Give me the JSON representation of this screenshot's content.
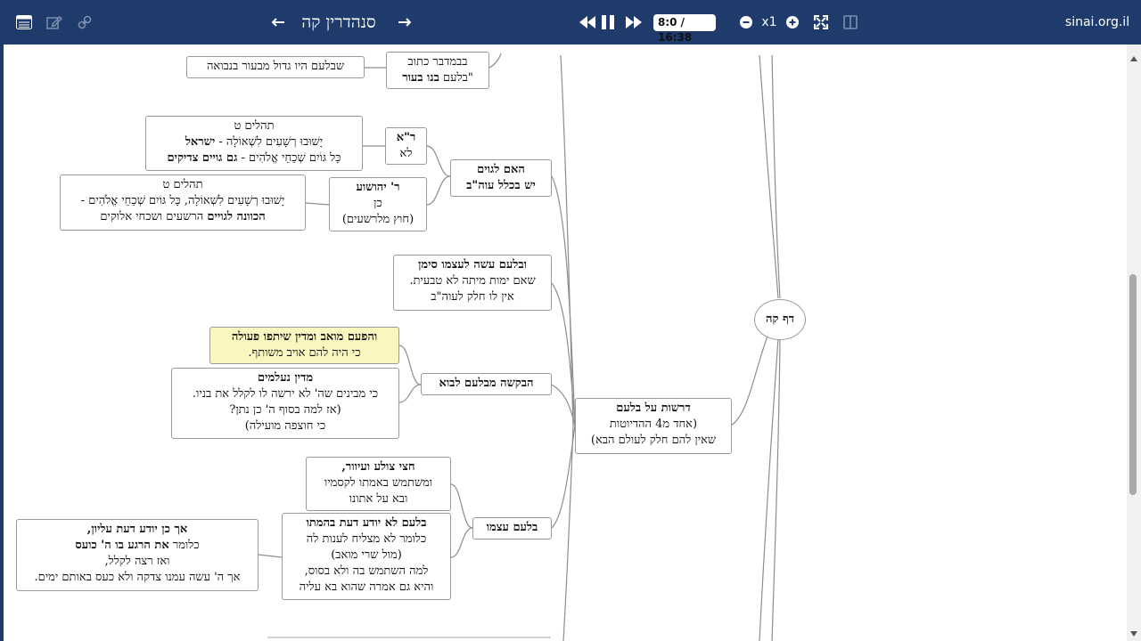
{
  "topbar": {
    "title": "סנהדרין קה",
    "time": "8:0 / 16:38",
    "zoom": "x1",
    "site": "sinai.org.il"
  },
  "nodes": {
    "daf": {
      "text": "דף קה"
    },
    "drashot": {
      "l1": "דרשות על בלעם",
      "l2": "(אחד מ4 ההדיוטות",
      "l3": "שאין להם חלק לעולם הבא)"
    },
    "bamidbar": {
      "l1": "בבמדבר כתוב",
      "l2a": "\"בלעם ",
      "l2b": "בנו בעור"
    },
    "navua": {
      "text": "שבלעם היו גדול מבעור בנבואה"
    },
    "goyim": {
      "l1": "האם לגוים",
      "l2": "יש בכלל עוה\"ב"
    },
    "ra": {
      "l1": "ר\"א",
      "l2": "לא"
    },
    "ryehoshua": {
      "l1": "ר' יהושוע",
      "l2": "כן",
      "l3": "(חוץ מלרשעים)"
    },
    "tehilim1": {
      "l1": "תהלים ט",
      "l2a": "יָשׁוּבוּ רְשָׁעִים לִשְׁאוֹלָה - ",
      "l2b": "ישראל",
      "l3a": "כָּל גּוֹיִם שְׁכֵחֵי אֱלֹהִים - ",
      "l3b": "גם גויים צדיקים"
    },
    "tehilim2": {
      "l1": "תהלים ט",
      "l2": "יָשׁוּבוּ רְשָׁעִים לִשְׁאוֹלָה,   כָּל גּוֹיִם שְׁכֵחֵי אֱלֹהִים -",
      "l3a": "הכוונה לגויים",
      "l3b": " הרשעים ושכחי אלוקים"
    },
    "siman": {
      "l1": "ובלעם עשה לעצמו סימן",
      "l2": "שאם ימות מיתה לא טבעית.",
      "l3": "אין לו חלק לעוה\"ב"
    },
    "bakasha": {
      "text": "הבקשה מבלעם לבוא"
    },
    "moav": {
      "l1": "והפעם מואב ומדין שיתפו פעולה",
      "l2": "כי היה להם אויב משותף."
    },
    "midyan": {
      "l1": "מדין נעלמים",
      "l2": "כי מבינים  שה' לא ירשה לו לקלל את בניו.",
      "l3": "(אז למה בסוף ה' כן נתן?",
      "l4": "כי חוצפה מועילה)"
    },
    "atzmo": {
      "text": "בלעם עצמו"
    },
    "chatzi": {
      "l1": "חצי צולע ועיוור,",
      "l2": "ומשתמש באמתו לקסמיו",
      "l3": "ובא על אתונו"
    },
    "loyodea": {
      "l1": "בלעם לא יודע דעת בהמתו",
      "l2": "כלומר לא מצליח לענות לה",
      "l3": "(מול שרי מואב)",
      "l4": "למה השתמש בה ולא בסוס,",
      "l5": "והיא גם אמרה שהוא בא עליה"
    },
    "elyon": {
      "l1": "אך כן יודע דעת עליון,",
      "l2a": "כלומר  ",
      "l2b": "את הרגע בו ה' כועס",
      "l3": "ואז רצה לקלל,",
      "l4": "אך ה' עשה עמנו צדקה ולא כעס באותם ימים."
    }
  }
}
